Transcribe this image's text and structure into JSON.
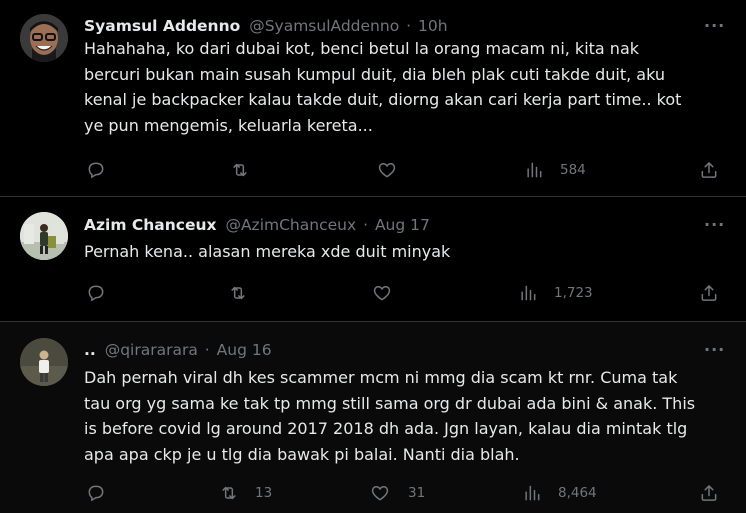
{
  "tweets": [
    {
      "name": "Syamsul Addenno",
      "handle": "@SyamsulAddenno",
      "separator": "·",
      "time": "10h",
      "more_icon": "···",
      "body_lines": [
        "Hahahaha, ko dari dubai kot, benci betul la orang macam ni, kita nak",
        "bercuri bukan main susah kumpul duit, dia bleh plak cuti takde duit, aku",
        "kenal je backpacker kalau takde duit, diorng akan cari kerja part time.. kot",
        "ye pun mengemis, keluarla kereta..."
      ],
      "replies": "",
      "retweets": "",
      "likes": "",
      "views": "584"
    },
    {
      "name": "Azim Chanceux",
      "handle": "@AzimChanceux",
      "separator": "·",
      "time": "Aug 17",
      "more_icon": "···",
      "body_lines": [
        "Pernah kena.. alasan mereka xde duit minyak"
      ],
      "replies": "",
      "retweets": "",
      "likes": "",
      "views": "1,723"
    },
    {
      "name": "..",
      "handle": "@qirararara",
      "separator": "·",
      "time": "Aug 16",
      "more_icon": "···",
      "body_lines": [
        "Dah pernah viral dh kes scammer mcm ni mmg dia scam kt rnr. Cuma tak",
        "tau org yg sama ke tak tp mmg still sama org dr dubai ada bini & anak. This",
        "is before covid lg around 2017 2018 dh ada. Jgn layan, kalau dia mintak tlg",
        "apa apa ckp je u tlg dia bawak pi balai. Nanti dia blah."
      ],
      "replies": "",
      "retweets": "13",
      "likes": "31",
      "views": "8,464"
    }
  ],
  "icons": {
    "reply": "reply-icon",
    "retweet": "retweet-icon",
    "like": "like-icon",
    "views": "views-icon",
    "share": "share-icon"
  },
  "colors": {
    "background": "#000000",
    "text": "#e7e9ea",
    "muted": "#71767b",
    "divider": "#2f3336"
  }
}
